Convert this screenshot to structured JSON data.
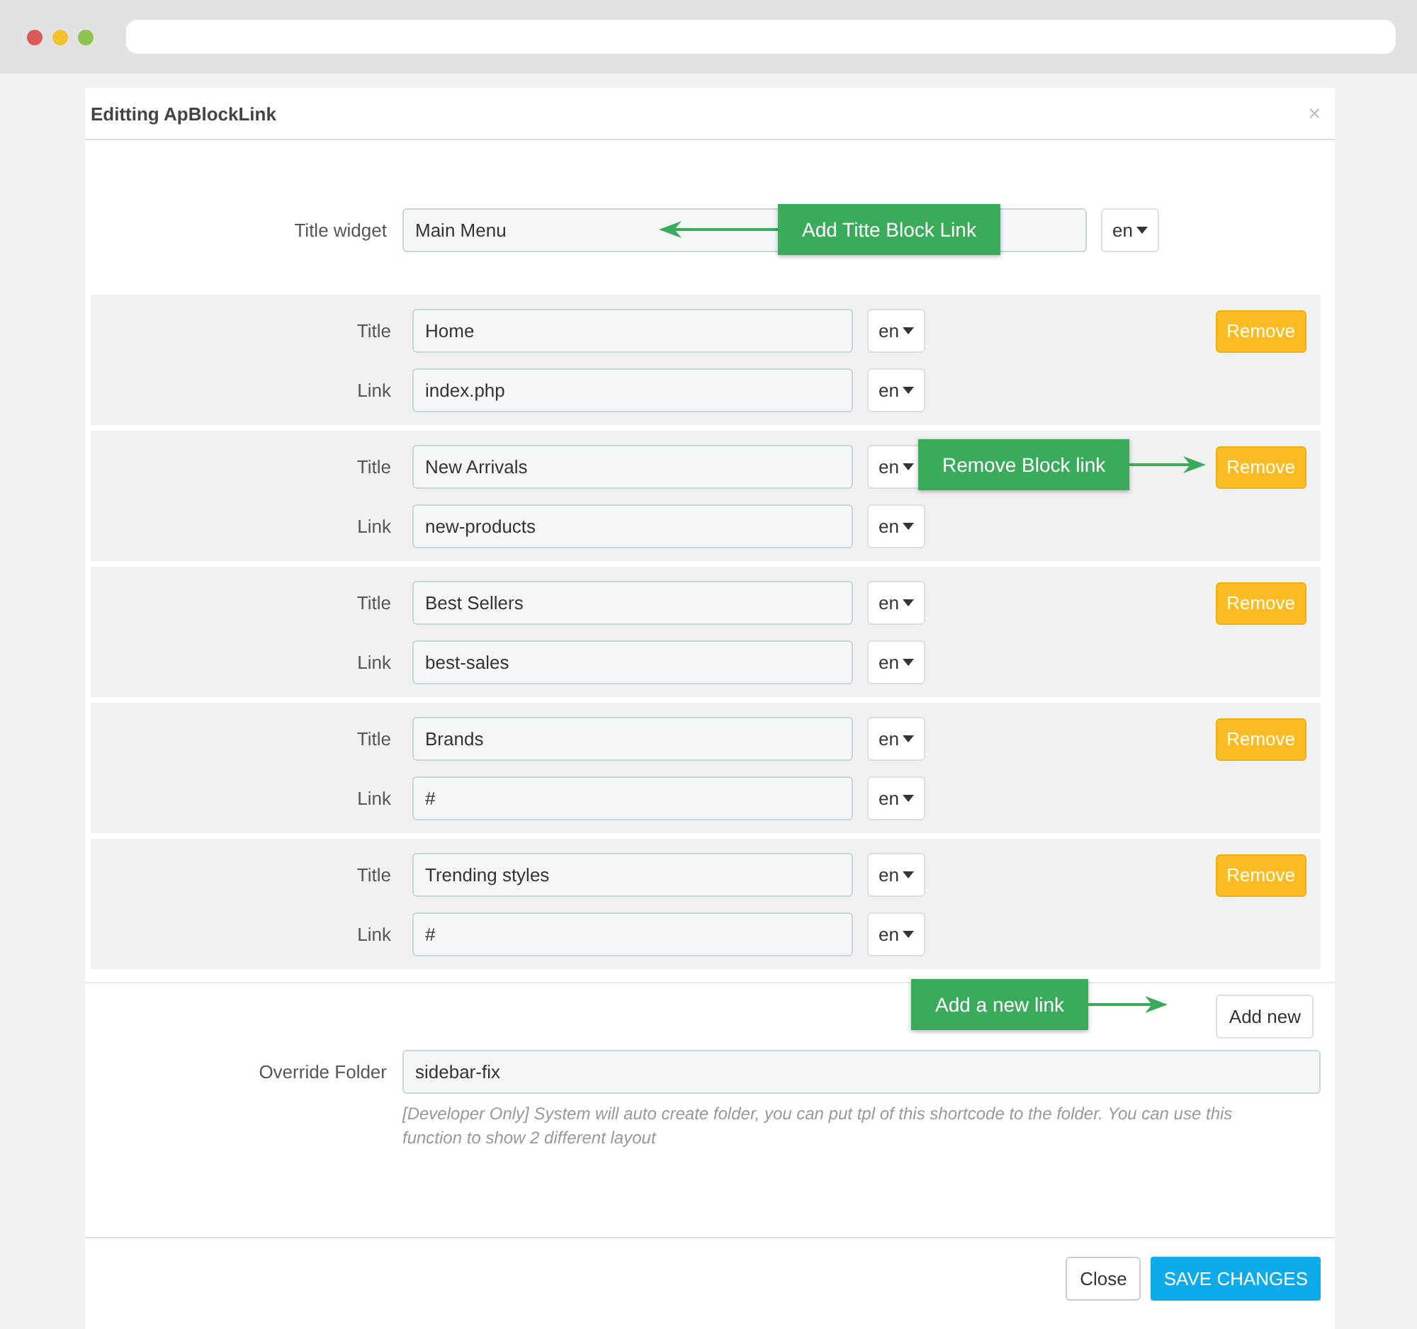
{
  "modal": {
    "title": "Editting ApBlockLink",
    "close": "×"
  },
  "title_widget": {
    "label": "Title widget",
    "value": "Main Menu",
    "lang": "en",
    "callout": {
      "text": "Add Titte Block Link",
      "kind": "left"
    }
  },
  "blocks": [
    {
      "title_label": "Title",
      "title": "Home",
      "title_lang": "en",
      "link_label": "Link",
      "link": "index.php",
      "link_lang": "en",
      "remove": "Remove"
    },
    {
      "title_label": "Title",
      "title": "New Arrivals",
      "title_lang": "en",
      "link_label": "Link",
      "link": "new-products",
      "link_lang": "en",
      "remove": "Remove",
      "callout": {
        "text": "Remove Block link",
        "kind": "right"
      }
    },
    {
      "title_label": "Title",
      "title": "Best Sellers",
      "title_lang": "en",
      "link_label": "Link",
      "link": "best-sales",
      "link_lang": "en",
      "remove": "Remove"
    },
    {
      "title_label": "Title",
      "title": "Brands",
      "title_lang": "en",
      "link_label": "Link",
      "link": "#",
      "link_lang": "en",
      "remove": "Remove"
    },
    {
      "title_label": "Title",
      "title": "Trending styles",
      "title_lang": "en",
      "link_label": "Link",
      "link": "#",
      "link_lang": "en",
      "remove": "Remove"
    }
  ],
  "add_new": {
    "label": "Add new",
    "callout": {
      "text": "Add a new link",
      "kind": "right"
    }
  },
  "override_folder": {
    "label": "Override Folder",
    "value": "sidebar-fix",
    "help": "[Developer Only] System will auto create folder, you can put tpl of this shortcode to the folder. You can use this function to show 2 different layout"
  },
  "footer": {
    "close": "Close",
    "save": "SAVE CHANGES"
  }
}
